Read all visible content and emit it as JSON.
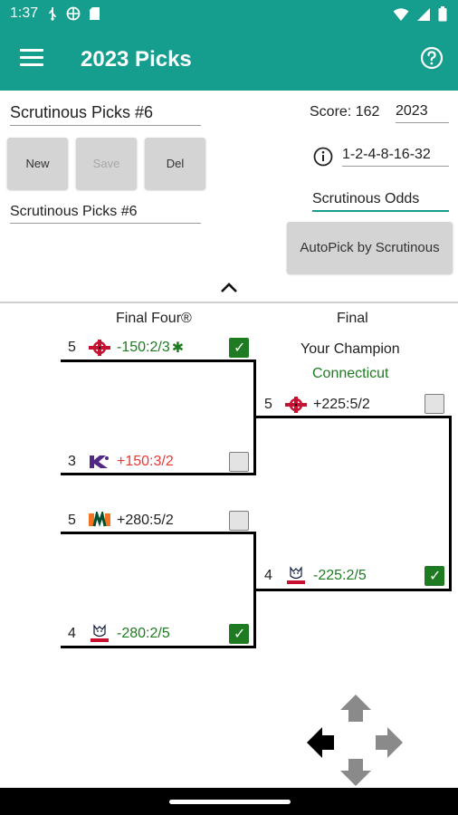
{
  "status": {
    "time": "1:37"
  },
  "appbar": {
    "title": "2023 Picks"
  },
  "picks": {
    "name_value": "Scrutinous Picks #6",
    "new_label": "New",
    "save_label": "Save",
    "del_label": "Del",
    "secondary_value": "Scrutinous Picks #6"
  },
  "score": {
    "label": "Score:",
    "value": "162",
    "year": "2023"
  },
  "scoring": {
    "value": "1-2-4-8-16-32"
  },
  "odds_source": "Scrutinous Odds",
  "autopick_label": "AutoPick by Scrutinous",
  "bracket": {
    "final_four_header": "Final Four®",
    "final_header": "Final",
    "champion_label": "Your Champion",
    "champion_name": "Connecticut",
    "semi1": {
      "top": {
        "seed": "5",
        "odds": "-150:2/3",
        "marker": "✱",
        "logo": "san-diego-state-logo",
        "checked": true
      },
      "bottom": {
        "seed": "3",
        "odds": "+150:3/2",
        "logo": "kansas-state-logo",
        "checked": false
      }
    },
    "semi2": {
      "top": {
        "seed": "5",
        "odds": "+280:5/2",
        "logo": "miami-logo",
        "checked": false
      },
      "bottom": {
        "seed": "4",
        "odds": "-280:2/5",
        "logo": "uconn-logo",
        "checked": true
      }
    },
    "final": {
      "top": {
        "seed": "5",
        "odds": "+225:5/2",
        "logo": "san-diego-state-logo",
        "checked": false
      },
      "bottom": {
        "seed": "4",
        "odds": "-225:2/5",
        "logo": "uconn-logo",
        "checked": true
      }
    }
  },
  "colors": {
    "primary": "#159e8e",
    "favorite": "#1e7b21",
    "underdog": "#e53935",
    "check_on": "#1e7b21"
  },
  "icons": [
    "menu-icon",
    "help-icon",
    "info-icon",
    "collapse-chevron-icon",
    "arrow-left-icon",
    "arrow-right-icon",
    "arrow-up-icon",
    "arrow-down-icon"
  ]
}
